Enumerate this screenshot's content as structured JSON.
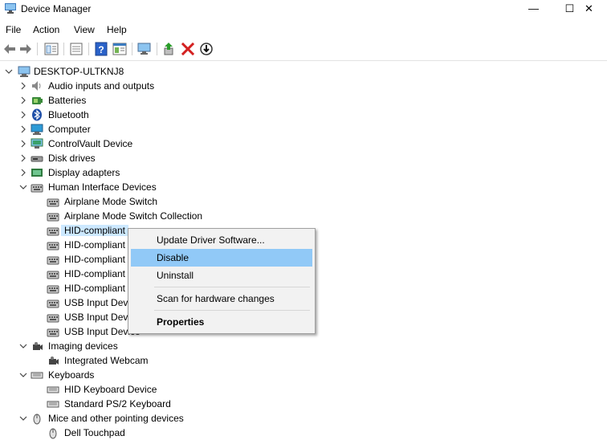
{
  "window": {
    "title": "Device Manager",
    "minimize": "—",
    "maximize": "☐",
    "close": "✕"
  },
  "menu": [
    "File",
    "Action",
    "View",
    "Help"
  ],
  "toolbar": [
    "back-icon",
    "forward-icon",
    "properties-icon",
    "show-hidden-icon",
    "help-icon",
    "view-icon",
    "scan-hardware-icon",
    "update-driver-icon",
    "uninstall-icon",
    "disable-icon"
  ],
  "tree": {
    "root": "DESKTOP-ULTKNJ8",
    "rows": [
      {
        "label": "Audio inputs and outputs",
        "icon": "speaker-icon"
      },
      {
        "label": "Batteries",
        "icon": "battery-icon"
      },
      {
        "label": "Bluetooth",
        "icon": "bluetooth-icon"
      },
      {
        "label": "Computer",
        "icon": "computer-icon"
      },
      {
        "label": "ControlVault Device",
        "icon": "controlvault-icon"
      },
      {
        "label": "Disk drives",
        "icon": "disk-drive-icon"
      },
      {
        "label": "Display adapters",
        "icon": "display-adapter-icon"
      },
      {
        "label": "Human Interface Devices",
        "icon": "hid-icon"
      },
      {
        "label": "Airplane Mode Switch",
        "icon": "hid-icon"
      },
      {
        "label": "Airplane Mode Switch Collection",
        "icon": "hid-icon"
      },
      {
        "label": "HID-compliant",
        "icon": "hid-icon"
      },
      {
        "label": "HID-compliant",
        "icon": "hid-icon"
      },
      {
        "label": "HID-compliant",
        "icon": "hid-icon"
      },
      {
        "label": "HID-compliant",
        "icon": "hid-icon"
      },
      {
        "label": "HID-compliant",
        "icon": "hid-icon"
      },
      {
        "label": "USB Input Devic",
        "icon": "hid-icon"
      },
      {
        "label": "USB Input Devic",
        "icon": "hid-icon"
      },
      {
        "label": "USB Input Device",
        "icon": "hid-icon"
      },
      {
        "label": "Imaging devices",
        "icon": "camera-icon"
      },
      {
        "label": "Integrated Webcam",
        "icon": "camera-icon"
      },
      {
        "label": "Keyboards",
        "icon": "keyboard-icon"
      },
      {
        "label": "HID Keyboard Device",
        "icon": "keyboard-icon"
      },
      {
        "label": "Standard PS/2 Keyboard",
        "icon": "keyboard-icon"
      },
      {
        "label": "Mice and other pointing devices",
        "icon": "mouse-icon"
      },
      {
        "label": "Dell Touchpad",
        "icon": "mouse-icon"
      }
    ]
  },
  "context_menu": {
    "items": [
      "Update Driver Software...",
      "Disable",
      "Uninstall",
      "Scan for hardware changes",
      "Properties"
    ]
  },
  "colors": {
    "hover_row": "#cce8ff",
    "menu_highlight": "#91c9f7",
    "remove_red": "#d32020",
    "update_green": "#2a9c2a"
  }
}
